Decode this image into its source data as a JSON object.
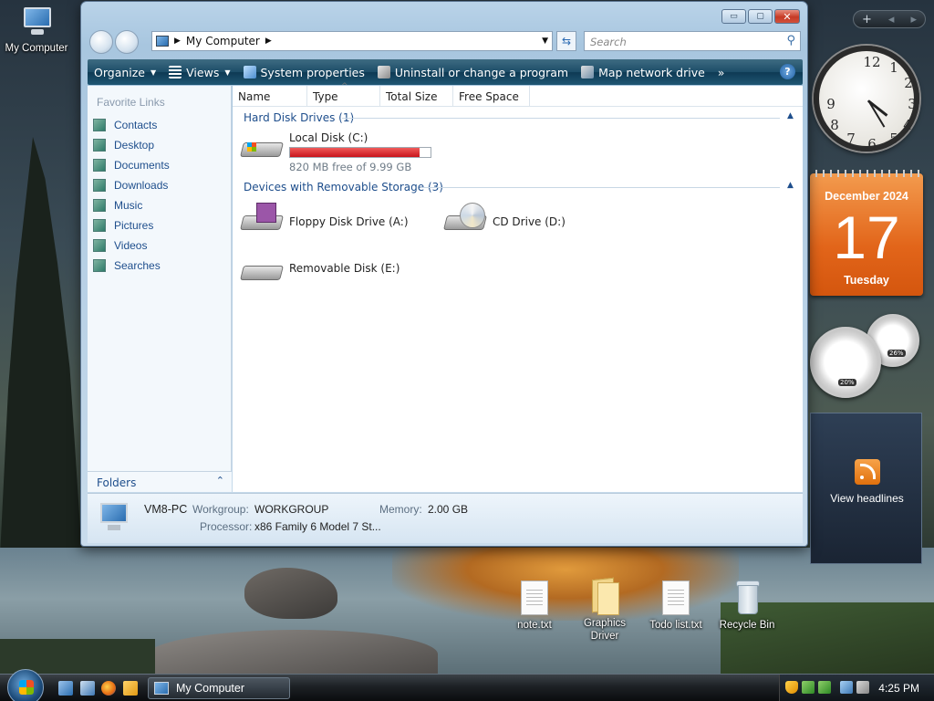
{
  "desktop": {
    "icons": {
      "my_computer": "My Computer",
      "note": "note.txt",
      "graphics_driver": "Graphics Driver",
      "todo": "Todo list.txt",
      "recycle_bin": "Recycle Bin"
    }
  },
  "sidebar": {
    "toolbar": {
      "add": "+",
      "prev": "◂",
      "next": "▸"
    },
    "calendar": {
      "month": "December 2024",
      "day": "17",
      "weekday": "Tuesday"
    },
    "meters": {
      "cpu": "20%",
      "memory": "26%"
    },
    "feed": {
      "label": "View headlines"
    }
  },
  "window": {
    "title_buttons": {
      "min": "▭",
      "max": "▢",
      "close": "✕"
    },
    "address": {
      "path": "My Computer"
    },
    "search": {
      "placeholder": "Search"
    },
    "commands": {
      "organize": "Organize",
      "views": "Views",
      "system_properties": "System properties",
      "uninstall": "Uninstall or change a program",
      "map_drive": "Map network drive",
      "more": "»",
      "help": "?"
    },
    "nav": {
      "favorite_links": "Favorite Links",
      "items": [
        "Contacts",
        "Desktop",
        "Documents",
        "Downloads",
        "Music",
        "Pictures",
        "Videos",
        "Searches"
      ],
      "folders": "Folders"
    },
    "columns": [
      "Name",
      "Type",
      "Total Size",
      "Free Space"
    ],
    "groups": {
      "hdd": "Hard Disk Drives (1)",
      "removable": "Devices with Removable Storage (3)"
    },
    "drives": {
      "c": {
        "name": "Local Disk (C:)",
        "free": "820 MB free of 9.99 GB",
        "used_fraction": 0.92
      },
      "a": {
        "name": "Floppy Disk Drive (A:)"
      },
      "d": {
        "name": "CD Drive (D:)"
      },
      "e": {
        "name": "Removable Disk (E:)"
      }
    },
    "details": {
      "computer_name": "VM8-PC",
      "workgroup_label": "Workgroup:",
      "workgroup": "WORKGROUP",
      "memory_label": "Memory:",
      "memory": "2.00 GB",
      "processor_label": "Processor:",
      "processor": "x86 Family 6 Model 7 St..."
    }
  },
  "taskbar": {
    "task": "My Computer",
    "clock": "4:25 PM"
  },
  "colors": {
    "accent": "#1e4e8c",
    "calendar": "#e2651a",
    "disk_bar": "#c8141c"
  }
}
